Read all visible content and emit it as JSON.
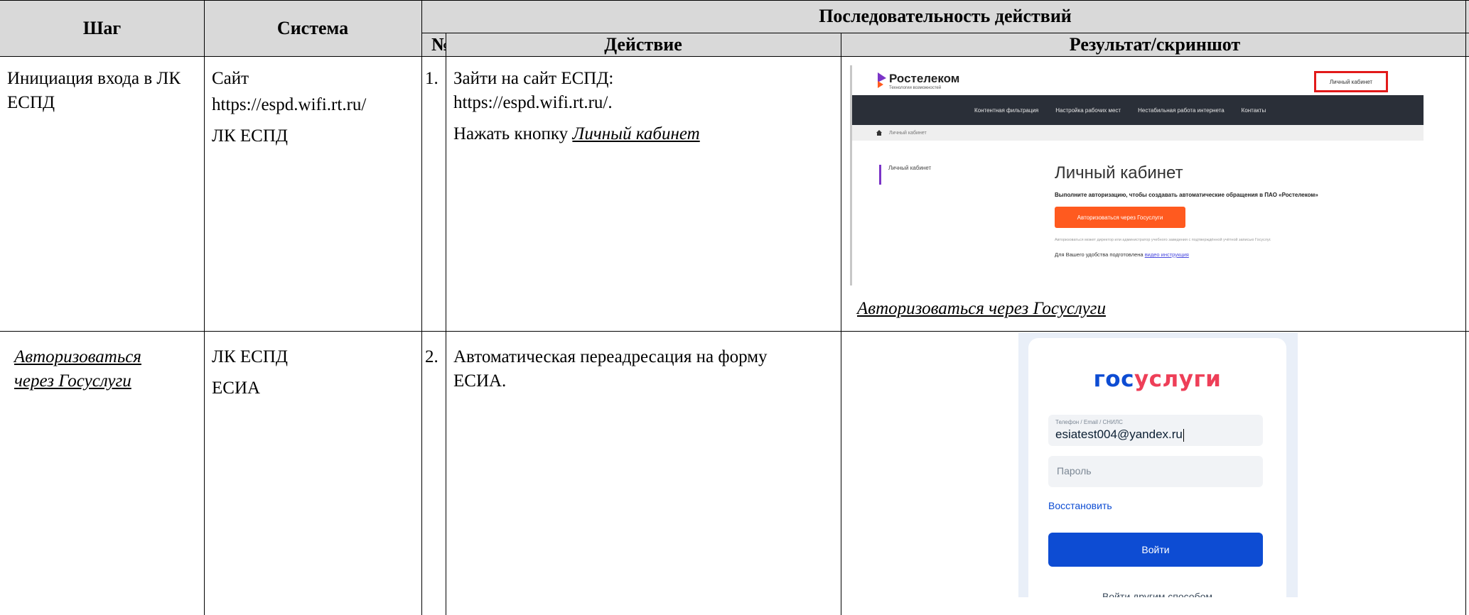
{
  "headers": {
    "step": "Шаг",
    "system": "Система",
    "sequence": "Последовательность действий",
    "number": "№",
    "action": "Действие",
    "result": "Результат/скриншот"
  },
  "rows": [
    {
      "step": "Инициация входа в ЛК ЕСПД",
      "system_lines": [
        "Сайт",
        "https://espd.wifi.rt.ru/",
        "ЛК ЕСПД"
      ],
      "number": "1.",
      "action_line1": "Зайти на сайт ЕСПД:",
      "action_line2": "https://espd.wifi.rt.ru/.",
      "action_press": "Нажать кнопку ",
      "action_link": "Личный кабинет",
      "result_caption": "Авторизоваться через Госуслуги"
    },
    {
      "step_line1": "Авторизоваться",
      "step_line2": "через Госуслуги",
      "system_lines": [
        "ЛК ЕСПД",
        "ЕСИА"
      ],
      "number": "2.",
      "action_line1": "Автоматическая переадресация на форму",
      "action_line2": "ЕСИА."
    }
  ],
  "screenshot1": {
    "logo_name": "Ростелеком",
    "logo_tagline": "Технологии возможностей",
    "lk_button": "Личный кабинет",
    "nav": [
      "Контентная фильтрация",
      "Настройка рабочих мест",
      "Нестабильная работа интернета",
      "Контакты"
    ],
    "breadcrumb_home_icon": "home-icon",
    "breadcrumb": "Личный кабинет",
    "sidebar_item": "Личный кабинет",
    "title": "Личный кабинет",
    "subtitle": "Выполните авторизацию, чтобы создавать автоматические обращения в ПАО «Ростелеком»",
    "gosuslugi_button": "Авторизоваться через Госуслуги",
    "note": "Авторизоваться может директор или администратор учебного заведения с подтверждённой учётной записью Госуслуг.",
    "help_prefix": "Для Вашего удобства подготовлена ",
    "help_link": "видео инструкция",
    "accent_color": "#ff5a1f",
    "highlight_color": "#e21a1a"
  },
  "screenshot2": {
    "logo_part1": "гос",
    "logo_part2": "услуги",
    "login_label": "Телефон / Email / СНИЛС",
    "login_value": "esiatest004@yandex.ru",
    "password_placeholder": "Пароль",
    "restore_link": "Восстановить",
    "login_button": "Войти",
    "alt_login": "Войти другим способом",
    "brand_blue": "#0d4cd3",
    "brand_red": "#ee3f58"
  }
}
